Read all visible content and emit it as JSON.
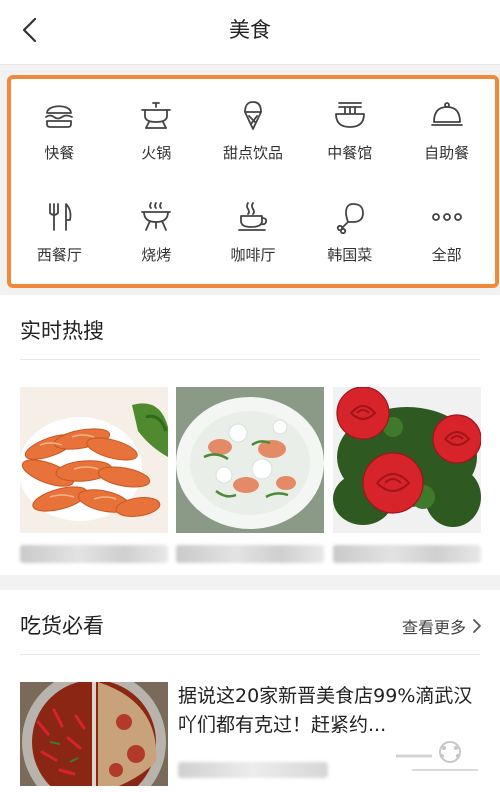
{
  "header": {
    "title": "美食",
    "back_icon": "chevron-left-icon"
  },
  "categories": [
    {
      "label": "快餐",
      "icon": "burger-icon"
    },
    {
      "label": "火锅",
      "icon": "hotpot-icon"
    },
    {
      "label": "甜点饮品",
      "icon": "ice-cream-icon"
    },
    {
      "label": "中餐馆",
      "icon": "noodle-bowl-icon"
    },
    {
      "label": "自助餐",
      "icon": "cloche-icon"
    },
    {
      "label": "西餐厅",
      "icon": "fork-knife-icon"
    },
    {
      "label": "烧烤",
      "icon": "grill-icon"
    },
    {
      "label": "咖啡厅",
      "icon": "coffee-cup-icon"
    },
    {
      "label": "韩国菜",
      "icon": "drumstick-icon"
    },
    {
      "label": "全部",
      "icon": "more-dots-icon"
    }
  ],
  "hot": {
    "title": "实时热搜",
    "items": [
      {
        "image": "shrimp-photo"
      },
      {
        "image": "soup-photo"
      },
      {
        "image": "tomato-rose-photo"
      }
    ]
  },
  "must_see": {
    "title": "吃货必看",
    "more_label": "查看更多",
    "article": {
      "title": "据说这20家新晋美食店99%滴武汉吖们都有克过！赶紧约...",
      "image": "hotpot-photo"
    }
  },
  "colors": {
    "highlight_border": "#f08a3a",
    "accent_red": "#d6242a"
  }
}
